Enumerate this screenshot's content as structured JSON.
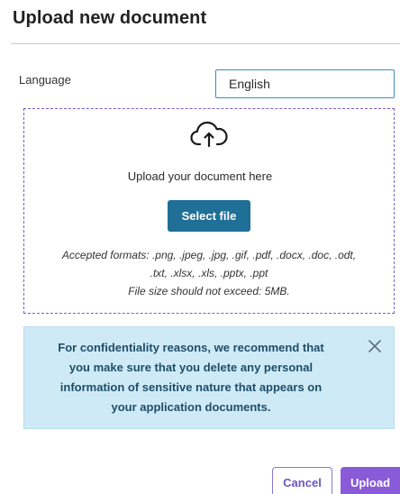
{
  "dialog": {
    "title": "Upload new document"
  },
  "language": {
    "label": "Language",
    "value": "English"
  },
  "dropzone": {
    "icon": "cloud-upload-icon",
    "prompt": "Upload your document here",
    "select_button": "Select file",
    "formats_line1": "Accepted formats: .png, .jpeg, .jpg, .gif, .pdf, .docx, .doc, .odt,",
    "formats_line2": ".txt, .xlsx, .xls, .pptx, .ppt",
    "size_limit": "File size should not exceed: 5MB."
  },
  "notice": {
    "line1": "For confidentiality reasons, we recommend that",
    "line2": "you make sure that you delete any personal",
    "line3": "information of sensitive nature that appears on",
    "line4": "your application documents.",
    "close_icon": "close-icon",
    "color_bg": "#cfeaf7"
  },
  "footer": {
    "cancel": "Cancel",
    "upload": "Upload"
  },
  "colors": {
    "primary_button": "#1f6f96",
    "accent_purple": "#8a5bd8",
    "dashed_border": "#7a5ec9"
  }
}
